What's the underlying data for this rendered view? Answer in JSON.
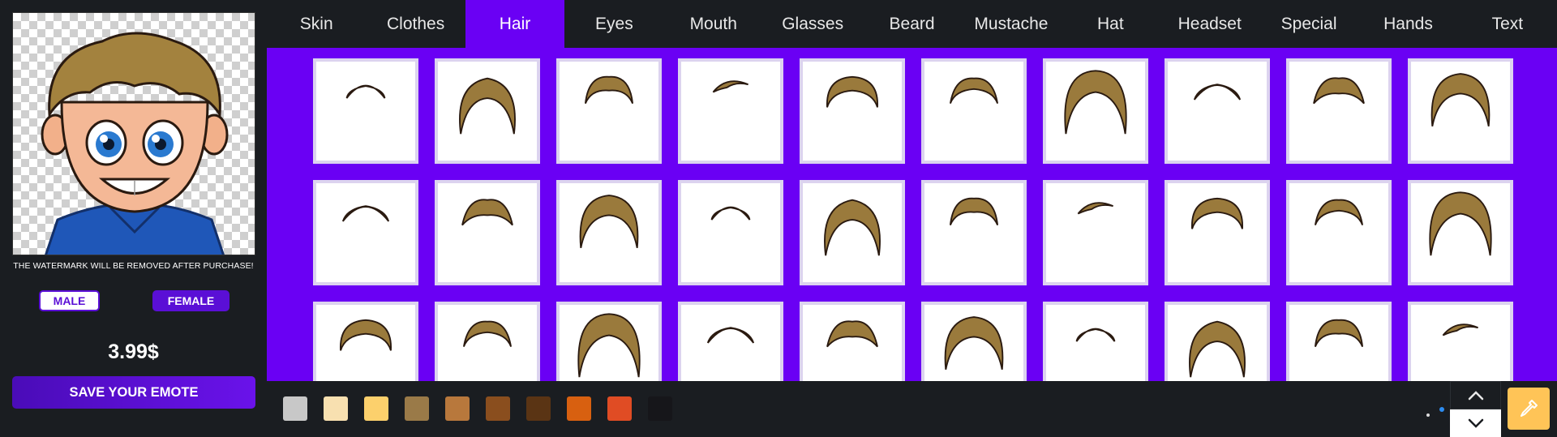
{
  "preview": {
    "watermark_note": "THE WATERMARK WILL BE REMOVED AFTER PURCHASE!"
  },
  "gender": {
    "male_label": "MALE",
    "female_label": "FEMALE",
    "selected": "MALE"
  },
  "price": "3.99$",
  "save_label": "SAVE YOUR EMOTE",
  "tabs": [
    {
      "label": "Skin"
    },
    {
      "label": "Clothes"
    },
    {
      "label": "Hair"
    },
    {
      "label": "Eyes"
    },
    {
      "label": "Mouth"
    },
    {
      "label": "Glasses"
    },
    {
      "label": "Beard"
    },
    {
      "label": "Mustache"
    },
    {
      "label": "Hat"
    },
    {
      "label": "Headset"
    },
    {
      "label": "Special"
    },
    {
      "label": "Hands"
    },
    {
      "label": "Text"
    }
  ],
  "active_tab": "Hair",
  "hair_styles_visible": 30,
  "hair_color": "#9a7a3c",
  "accent_color": "#6a00f4",
  "swatches": [
    "#c8c8c8",
    "#f8e0b0",
    "#fcd06c",
    "#9a7a48",
    "#b8783c",
    "#8a4e1e",
    "#5a3414",
    "#d86010",
    "#e04c24",
    "#16161a"
  ],
  "icons": {
    "scroll_up": "chevron-up-icon",
    "scroll_down": "chevron-down-icon",
    "color_picker": "eyedropper-icon"
  }
}
